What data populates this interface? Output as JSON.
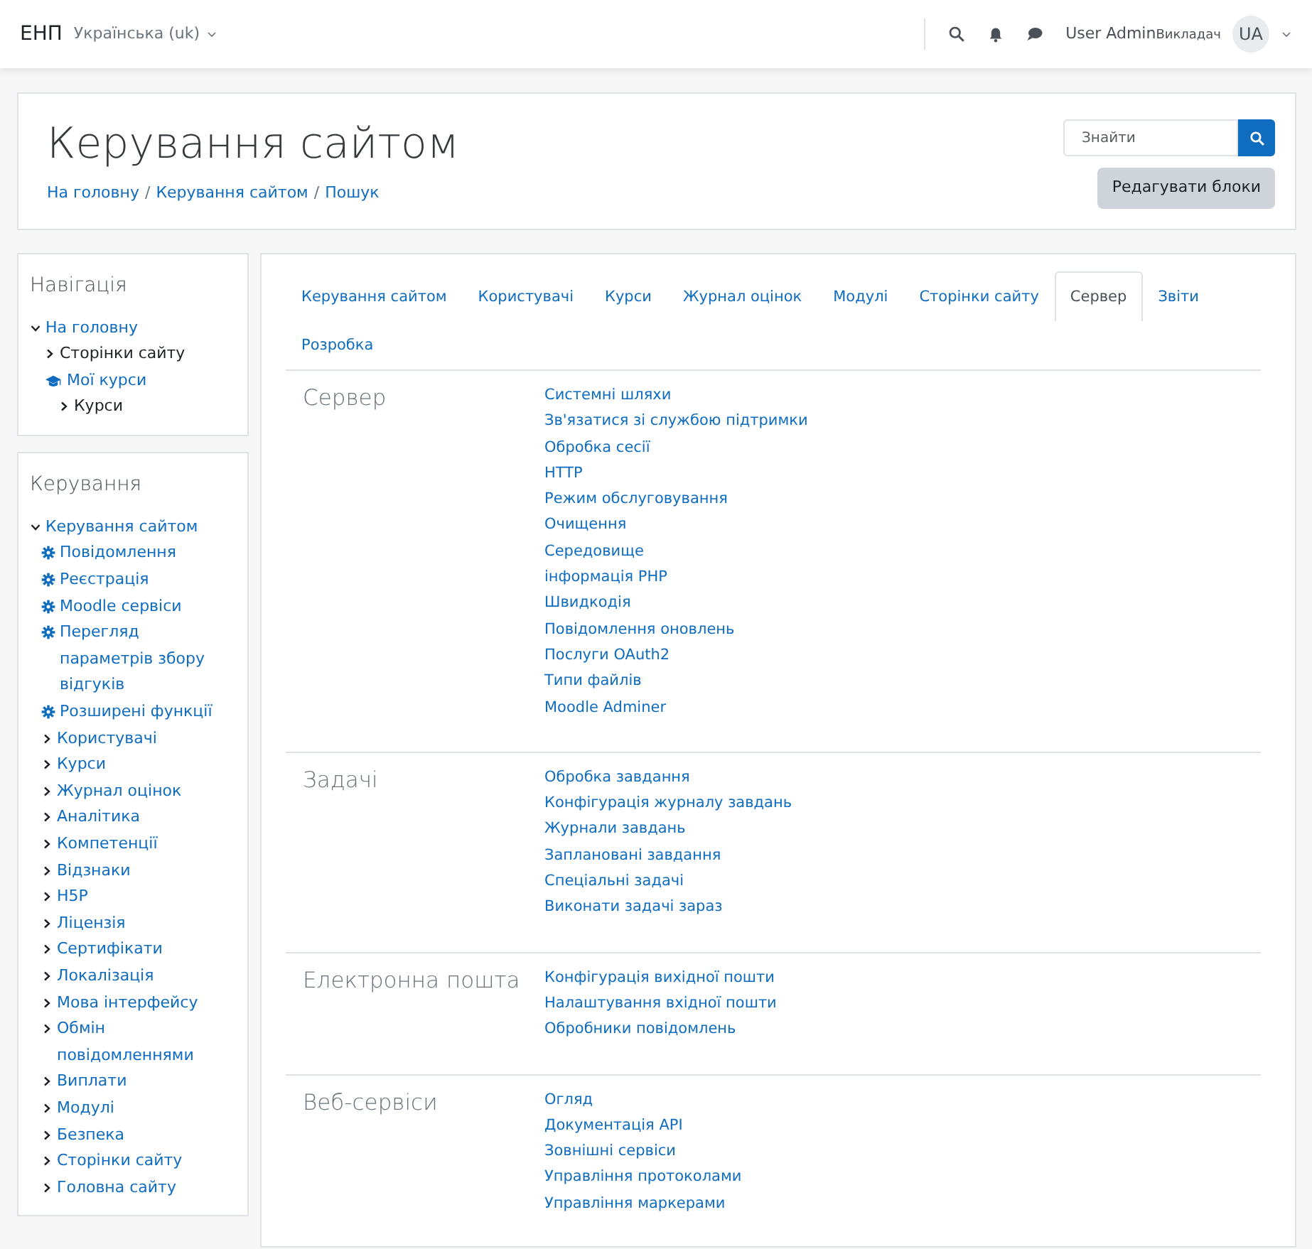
{
  "navbar": {
    "brand": "ЕНП",
    "language": "Українська (uk)",
    "user_name": "User Admin",
    "user_role": "Викладач",
    "avatar_initials": "UA"
  },
  "header": {
    "title": "Керування сайтом",
    "breadcrumbs": [
      "На головну",
      "Керування сайтом",
      "Пошук"
    ],
    "breadcrumb_separator": "/",
    "search": {
      "placeholder": "Знайти"
    },
    "edit_button": "Редагувати блоки"
  },
  "blocks": [
    {
      "title": "Навігація",
      "items": [
        {
          "label": "На головну",
          "kind": "branch",
          "expanded": true,
          "children": [
            {
              "label": "Сторінки сайту",
              "kind": "branch",
              "expanded": false
            },
            {
              "label": "Мої курси",
              "kind": "courses",
              "children": [
                {
                  "label": "Курси",
                  "kind": "branch",
                  "expanded": false
                }
              ]
            }
          ]
        }
      ]
    },
    {
      "title": "Керування",
      "items": [
        {
          "label": "Керування сайтом",
          "kind": "branch",
          "expanded": true,
          "children": [
            {
              "label": "Повідомлення",
              "kind": "setting"
            },
            {
              "label": "Реєстрація",
              "kind": "setting"
            },
            {
              "label": "Moodle сервіси",
              "kind": "setting"
            },
            {
              "label": "Перегляд параметрів збору відгуків",
              "kind": "setting"
            },
            {
              "label": "Розширені функції",
              "kind": "setting"
            },
            {
              "label": "Користувачі",
              "kind": "branch",
              "expanded": false
            },
            {
              "label": "Курси",
              "kind": "branch",
              "expanded": false
            },
            {
              "label": "Журнал оцінок",
              "kind": "branch",
              "expanded": false
            },
            {
              "label": "Аналітика",
              "kind": "branch",
              "expanded": false
            },
            {
              "label": "Компетенції",
              "kind": "branch",
              "expanded": false
            },
            {
              "label": "Відзнаки",
              "kind": "branch",
              "expanded": false
            },
            {
              "label": "H5P",
              "kind": "branch",
              "expanded": false
            },
            {
              "label": "Ліцензія",
              "kind": "branch",
              "expanded": false
            },
            {
              "label": "Сертифікати",
              "kind": "branch",
              "expanded": false
            },
            {
              "label": "Локалізація",
              "kind": "branch",
              "expanded": false
            },
            {
              "label": "Мова інтерфейсу",
              "kind": "branch",
              "expanded": false
            },
            {
              "label": "Обмін повідомленнями",
              "kind": "branch",
              "expanded": false
            },
            {
              "label": "Виплати",
              "kind": "branch",
              "expanded": false
            },
            {
              "label": "Модулі",
              "kind": "branch",
              "expanded": false
            },
            {
              "label": "Безпека",
              "kind": "branch",
              "expanded": false
            },
            {
              "label": "Сторінки сайту",
              "kind": "branch",
              "expanded": false
            },
            {
              "label": "Головна сайту",
              "kind": "branch",
              "expanded": false
            }
          ]
        }
      ]
    }
  ],
  "tabs": [
    {
      "label": "Керування сайтом",
      "selected": false
    },
    {
      "label": "Користувачі",
      "selected": false
    },
    {
      "label": "Курси",
      "selected": false
    },
    {
      "label": "Журнал оцінок",
      "selected": false
    },
    {
      "label": "Модулі",
      "selected": false
    },
    {
      "label": "Сторінки сайту",
      "selected": false
    },
    {
      "label": "Сервер",
      "selected": true
    },
    {
      "label": "Звіти",
      "selected": false
    },
    {
      "label": "Розробка",
      "selected": false
    }
  ],
  "sections": [
    {
      "title": "Сервер",
      "links": [
        "Системні шляхи",
        "Зв'язатися зі службою підтримки",
        "Обробка сесії",
        "HTTP",
        "Режим обслуговування",
        "Очищення",
        "Середовище",
        "інформація PHP",
        "Швидкодія",
        "Повідомлення оновлень",
        "Послуги OAuth2",
        "Типи файлів",
        "Moodle Adminer"
      ]
    },
    {
      "title": "Задачі",
      "links": [
        "Обробка завдання",
        "Конфігурація журналу завдань",
        "Журнали завдань",
        "Заплановані завдання",
        "Спеціальні задачі",
        "Виконати задачі зараз"
      ]
    },
    {
      "title": "Електронна пошта",
      "links": [
        "Конфігурація вихідної пошти",
        "Налаштування вхідної пошти",
        "Обробники повідомлень"
      ]
    },
    {
      "title": "Веб-сервіси",
      "links": [
        "Огляд",
        "Документація API",
        "Зовнішні сервіси",
        "Управління протоколами",
        "Управління маркерами"
      ]
    }
  ]
}
